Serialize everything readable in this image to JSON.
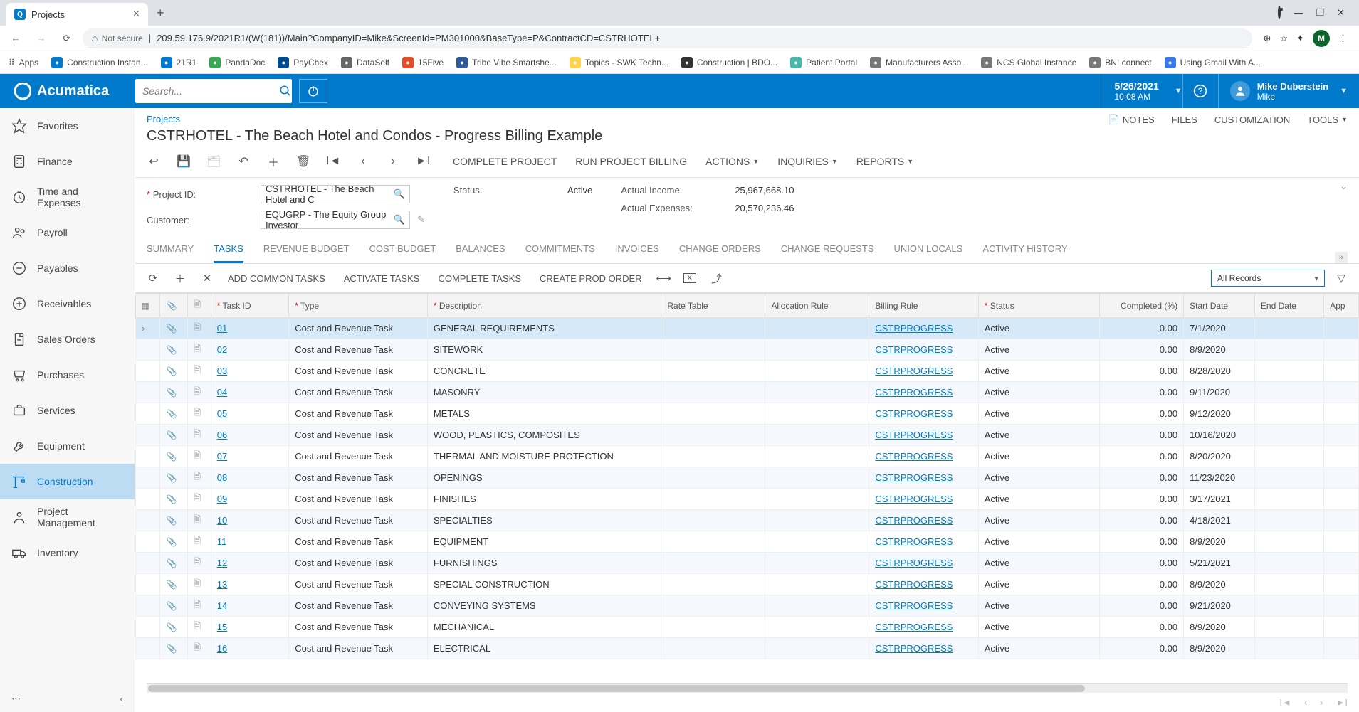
{
  "browser": {
    "tab_title": "Projects",
    "url_security": "Not secure",
    "url": "209.59.176.9/2021R1/(W(181))/Main?CompanyID=Mike&ScreenId=PM301000&BaseType=P&ContractCD=CSTRHOTEL+",
    "avatar_letter": "M",
    "bookmarks": [
      {
        "label": "Apps",
        "color": ""
      },
      {
        "label": "Construction Instan...",
        "color": "#027acc"
      },
      {
        "label": "21R1",
        "color": "#027acc"
      },
      {
        "label": "PandaDoc",
        "color": "#3aa657"
      },
      {
        "label": "PayChex",
        "color": "#004b8d"
      },
      {
        "label": "DataSelf",
        "color": "#666"
      },
      {
        "label": "15Five",
        "color": "#e44d26"
      },
      {
        "label": "Tribe Vibe Smartshe...",
        "color": "#2e5a9c"
      },
      {
        "label": "Topics - SWK Techn...",
        "color": "#ffd24d"
      },
      {
        "label": "Construction | BDO...",
        "color": "#333"
      },
      {
        "label": "Patient Portal",
        "color": "#4db8a9"
      },
      {
        "label": "Manufacturers Asso...",
        "color": "#777"
      },
      {
        "label": "NCS Global Instance",
        "color": "#777"
      },
      {
        "label": "BNI connect",
        "color": "#777"
      },
      {
        "label": "Using Gmail With A...",
        "color": "#3b78e7"
      }
    ]
  },
  "app": {
    "brand": "Acumatica",
    "search_placeholder": "Search...",
    "date": "5/26/2021",
    "time": "10:08 AM",
    "user_name": "Mike Duberstein",
    "user_tenant": "Mike"
  },
  "sidebar": {
    "items": [
      {
        "label": "Favorites",
        "svg": "star"
      },
      {
        "label": "Finance",
        "svg": "calc"
      },
      {
        "label": "Time and Expenses",
        "svg": "clock"
      },
      {
        "label": "Payroll",
        "svg": "people"
      },
      {
        "label": "Payables",
        "svg": "minus"
      },
      {
        "label": "Receivables",
        "svg": "plus"
      },
      {
        "label": "Sales Orders",
        "svg": "doc"
      },
      {
        "label": "Purchases",
        "svg": "cart"
      },
      {
        "label": "Services",
        "svg": "briefcase"
      },
      {
        "label": "Equipment",
        "svg": "wrench"
      },
      {
        "label": "Construction",
        "svg": "crane",
        "active": true
      },
      {
        "label": "Project Management",
        "svg": "person"
      },
      {
        "label": "Inventory",
        "svg": "truck"
      }
    ]
  },
  "page": {
    "breadcrumb": "Projects",
    "title": "CSTRHOTEL - The Beach Hotel and Condos - Progress Billing Example",
    "actions_right": [
      "NOTES",
      "FILES",
      "CUSTOMIZATION",
      "TOOLS"
    ],
    "toolbar_actions": [
      "COMPLETE PROJECT",
      "RUN PROJECT BILLING",
      "ACTIONS",
      "INQUIRIES",
      "REPORTS"
    ],
    "form": {
      "project_id_label": "Project ID:",
      "project_id_value": "CSTRHOTEL - The Beach Hotel and C",
      "customer_label": "Customer:",
      "customer_value": "EQUGRP - The Equity Group Investor",
      "status_label": "Status:",
      "status_value": "Active",
      "actual_income_label": "Actual Income:",
      "actual_income_value": "25,967,668.10",
      "actual_expenses_label": "Actual Expenses:",
      "actual_expenses_value": "20,570,236.46"
    },
    "tabs": [
      "SUMMARY",
      "TASKS",
      "REVENUE BUDGET",
      "COST BUDGET",
      "BALANCES",
      "COMMITMENTS",
      "INVOICES",
      "CHANGE ORDERS",
      "CHANGE REQUESTS",
      "UNION LOCALS",
      "ACTIVITY HISTORY"
    ],
    "active_tab": "TASKS",
    "grid_actions": [
      "ADD COMMON TASKS",
      "ACTIVATE TASKS",
      "COMPLETE TASKS",
      "CREATE PROD ORDER"
    ],
    "filter_label": "All Records",
    "columns": [
      "",
      "",
      "",
      "Task ID",
      "Type",
      "Description",
      "Rate Table",
      "Allocation Rule",
      "Billing Rule",
      "Status",
      "Completed (%)",
      "Start Date",
      "End Date",
      "App"
    ],
    "rows": [
      {
        "id": "01",
        "type": "Cost and Revenue Task",
        "desc": "GENERAL REQUIREMENTS",
        "billing": "CSTRPROGRESS",
        "status": "Active",
        "pct": "0.00",
        "start": "7/1/2020",
        "end": ""
      },
      {
        "id": "02",
        "type": "Cost and Revenue Task",
        "desc": "SITEWORK",
        "billing": "CSTRPROGRESS",
        "status": "Active",
        "pct": "0.00",
        "start": "8/9/2020",
        "end": ""
      },
      {
        "id": "03",
        "type": "Cost and Revenue Task",
        "desc": "CONCRETE",
        "billing": "CSTRPROGRESS",
        "status": "Active",
        "pct": "0.00",
        "start": "8/28/2020",
        "end": ""
      },
      {
        "id": "04",
        "type": "Cost and Revenue Task",
        "desc": "MASONRY",
        "billing": "CSTRPROGRESS",
        "status": "Active",
        "pct": "0.00",
        "start": "9/11/2020",
        "end": ""
      },
      {
        "id": "05",
        "type": "Cost and Revenue Task",
        "desc": "METALS",
        "billing": "CSTRPROGRESS",
        "status": "Active",
        "pct": "0.00",
        "start": "9/12/2020",
        "end": ""
      },
      {
        "id": "06",
        "type": "Cost and Revenue Task",
        "desc": "WOOD, PLASTICS, COMPOSITES",
        "billing": "CSTRPROGRESS",
        "status": "Active",
        "pct": "0.00",
        "start": "10/16/2020",
        "end": ""
      },
      {
        "id": "07",
        "type": "Cost and Revenue Task",
        "desc": "THERMAL AND MOISTURE PROTECTION",
        "billing": "CSTRPROGRESS",
        "status": "Active",
        "pct": "0.00",
        "start": "8/20/2020",
        "end": ""
      },
      {
        "id": "08",
        "type": "Cost and Revenue Task",
        "desc": "OPENINGS",
        "billing": "CSTRPROGRESS",
        "status": "Active",
        "pct": "0.00",
        "start": "11/23/2020",
        "end": ""
      },
      {
        "id": "09",
        "type": "Cost and Revenue Task",
        "desc": "FINISHES",
        "billing": "CSTRPROGRESS",
        "status": "Active",
        "pct": "0.00",
        "start": "3/17/2021",
        "end": ""
      },
      {
        "id": "10",
        "type": "Cost and Revenue Task",
        "desc": "SPECIALTIES",
        "billing": "CSTRPROGRESS",
        "status": "Active",
        "pct": "0.00",
        "start": "4/18/2021",
        "end": ""
      },
      {
        "id": "11",
        "type": "Cost and Revenue Task",
        "desc": "EQUIPMENT",
        "billing": "CSTRPROGRESS",
        "status": "Active",
        "pct": "0.00",
        "start": "8/9/2020",
        "end": ""
      },
      {
        "id": "12",
        "type": "Cost and Revenue Task",
        "desc": "FURNISHINGS",
        "billing": "CSTRPROGRESS",
        "status": "Active",
        "pct": "0.00",
        "start": "5/21/2021",
        "end": ""
      },
      {
        "id": "13",
        "type": "Cost and Revenue Task",
        "desc": "SPECIAL CONSTRUCTION",
        "billing": "CSTRPROGRESS",
        "status": "Active",
        "pct": "0.00",
        "start": "8/9/2020",
        "end": ""
      },
      {
        "id": "14",
        "type": "Cost and Revenue Task",
        "desc": "CONVEYING SYSTEMS",
        "billing": "CSTRPROGRESS",
        "status": "Active",
        "pct": "0.00",
        "start": "9/21/2020",
        "end": ""
      },
      {
        "id": "15",
        "type": "Cost and Revenue Task",
        "desc": "MECHANICAL",
        "billing": "CSTRPROGRESS",
        "status": "Active",
        "pct": "0.00",
        "start": "8/9/2020",
        "end": ""
      },
      {
        "id": "16",
        "type": "Cost and Revenue Task",
        "desc": "ELECTRICAL",
        "billing": "CSTRPROGRESS",
        "status": "Active",
        "pct": "0.00",
        "start": "8/9/2020",
        "end": ""
      }
    ]
  }
}
